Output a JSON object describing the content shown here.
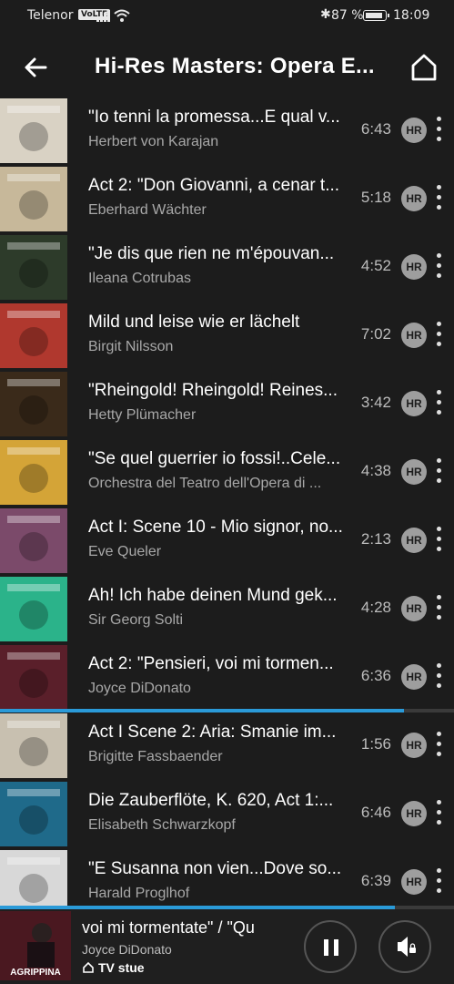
{
  "status_bar": {
    "carrier": "Telenor",
    "volte": "VoLTE",
    "battery": "87 %",
    "time": "18:09"
  },
  "header": {
    "title": "Hi-Res Masters: Opera E..."
  },
  "tracks": [
    {
      "title": "\"Io tenni la promessa...E qual v...",
      "artist": "Herbert von Karajan",
      "duration": "6:43",
      "badge": "HR",
      "art_color": "#d9d2c4"
    },
    {
      "title": "Act 2: \"Don Giovanni, a cenar t...",
      "artist": "Eberhard Wächter",
      "duration": "5:18",
      "badge": "HR",
      "art_color": "#c7b89a"
    },
    {
      "title": "\"Je dis que rien ne m'épouvan...",
      "artist": "Ileana Cotrubas",
      "duration": "4:52",
      "badge": "HR",
      "art_color": "#2d3b2a"
    },
    {
      "title": "Mild und leise wie er lächelt",
      "artist": "Birgit Nilsson",
      "duration": "7:02",
      "badge": "HR",
      "art_color": "#b0382e"
    },
    {
      "title": "\"Rheingold! Rheingold! Reines...",
      "artist": "Hetty Plümacher",
      "duration": "3:42",
      "badge": "HR",
      "art_color": "#3a2a1a"
    },
    {
      "title": "\"Se quel guerrier io fossi!..Cele...",
      "artist": "Orchestra del Teatro dell'Opera di ...",
      "duration": "4:38",
      "badge": "HR",
      "art_color": "#d4a437"
    },
    {
      "title": "Act I: Scene 10 - Mio signor, no...",
      "artist": "Eve Queler",
      "duration": "2:13",
      "badge": "HR",
      "art_color": "#7b4a6a"
    },
    {
      "title": "Ah! Ich habe deinen Mund gek...",
      "artist": "Sir Georg Solti",
      "duration": "4:28",
      "badge": "HR",
      "art_color": "#2bb38a"
    },
    {
      "title": "Act 2: \"Pensieri, voi mi tormen...",
      "artist": "Joyce DiDonato",
      "duration": "6:36",
      "badge": "HR",
      "art_color": "#5a1f2a"
    },
    {
      "title": "Act I Scene 2: Aria: Smanie im...",
      "artist": "Brigitte Fassbaender",
      "duration": "1:56",
      "badge": "HR",
      "art_color": "#c8c0b0"
    },
    {
      "title": "Die Zauberflöte, K. 620, Act 1:...",
      "artist": "Elisabeth Schwarzkopf",
      "duration": "6:46",
      "badge": "HR",
      "art_color": "#1f6a8a"
    },
    {
      "title": "\"E Susanna non vien...Dove so...",
      "artist": "Harald Proglhof",
      "duration": "6:39",
      "badge": "HR",
      "art_color": "#d8d8d8"
    }
  ],
  "now_playing_track_progress": 0.89,
  "mini_player": {
    "title": "voi mi tormentate\" / \"Qu",
    "artist": "Joyce DiDonato",
    "room": "TV stue",
    "progress": 0.87,
    "album_label": "AGRIPPINA"
  },
  "colors": {
    "accent": "#2a9ad8",
    "background": "#1c1c1c"
  }
}
